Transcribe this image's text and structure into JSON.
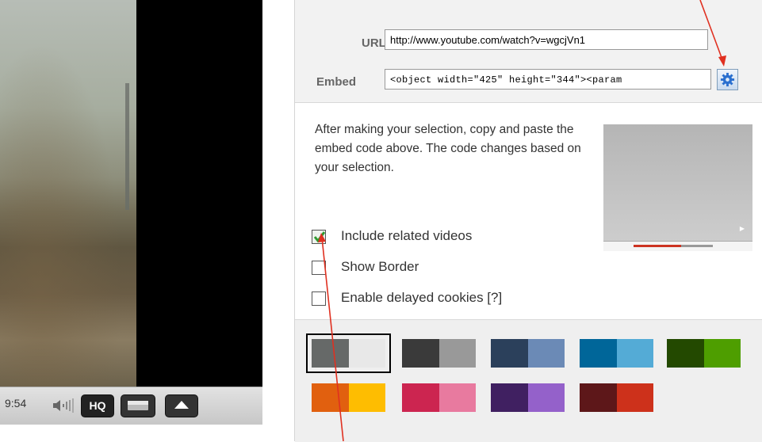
{
  "player": {
    "time": "9:54",
    "hq_label": "HQ",
    "icons": [
      "volume-icon",
      "hq-icon",
      "widescreen-icon",
      "eject-icon"
    ]
  },
  "embed_panel": {
    "url_label": "URL",
    "url_value": "http://www.youtube.com/watch?v=wgcjVn1",
    "embed_label": "Embed",
    "embed_value": "<object width=\"425\" height=\"344\"><param",
    "customize_icon": "gear-icon",
    "description": "After making your selection, copy and paste the embed code above. The code changes based on your selection.",
    "options": [
      {
        "label": "Include related videos",
        "checked": true
      },
      {
        "label": "Show Border",
        "checked": false
      },
      {
        "label": "Enable delayed cookies [?]",
        "checked": false
      }
    ],
    "color_themes": [
      {
        "c1": "#666968",
        "c2": "#e8e8e8",
        "selected": true
      },
      {
        "c1": "#3a3a3a",
        "c2": "#999999",
        "selected": false
      },
      {
        "c1": "#2b405b",
        "c2": "#6b8ab6",
        "selected": false
      },
      {
        "c1": "#006699",
        "c2": "#54abd6",
        "selected": false
      },
      {
        "c1": "#234900",
        "c2": "#4e9e00",
        "selected": false
      },
      {
        "c1": "#e1600f",
        "c2": "#febd01",
        "selected": false
      },
      {
        "c1": "#cc2550",
        "c2": "#e87a9f",
        "selected": false
      },
      {
        "c1": "#402061",
        "c2": "#9461ca",
        "selected": false
      },
      {
        "c1": "#5d1719",
        "c2": "#cd311b",
        "selected": false
      }
    ]
  },
  "annotation_color": "#e03020"
}
